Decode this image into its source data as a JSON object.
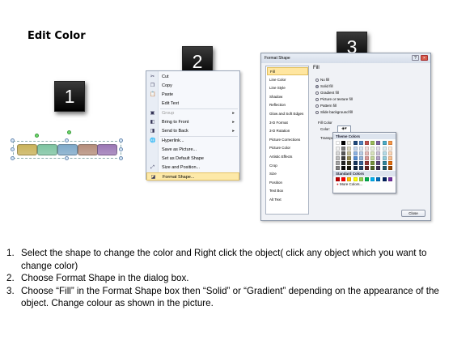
{
  "title": "Edit Color",
  "badges": [
    "1",
    "2",
    "3"
  ],
  "shape_colors": [
    "#c9b25a",
    "#7dc4a1",
    "#7ea9c9",
    "#b48e7b",
    "#9b78b5"
  ],
  "context_menu": {
    "items": [
      {
        "icon": "cut-icon",
        "glyph": "✂",
        "label": "Cut",
        "arrow": "",
        "disabled": false
      },
      {
        "icon": "copy-icon",
        "glyph": "❐",
        "label": "Copy",
        "arrow": "",
        "disabled": false
      },
      {
        "icon": "paste-icon",
        "glyph": "📋",
        "label": "Paste",
        "arrow": "",
        "disabled": false
      },
      {
        "icon": "",
        "glyph": "",
        "label": "Edit Text",
        "arrow": "",
        "disabled": false
      },
      {
        "icon": "group-icon",
        "glyph": "▣",
        "label": "Group",
        "arrow": "▸",
        "disabled": true
      },
      {
        "icon": "bring-to-front-icon",
        "glyph": "◧",
        "label": "Bring to Front",
        "arrow": "▸",
        "disabled": false
      },
      {
        "icon": "send-to-back-icon",
        "glyph": "◨",
        "label": "Send to Back",
        "arrow": "▸",
        "disabled": false
      },
      {
        "icon": "hyperlink-icon",
        "glyph": "🌐",
        "label": "Hyperlink...",
        "arrow": "",
        "disabled": false
      },
      {
        "icon": "",
        "glyph": "",
        "label": "Save as Picture...",
        "arrow": "",
        "disabled": false
      },
      {
        "icon": "",
        "glyph": "",
        "label": "Set as Default Shape",
        "arrow": "",
        "disabled": false
      },
      {
        "icon": "size-position-icon",
        "glyph": "⤢",
        "label": "Size and Position...",
        "arrow": "",
        "disabled": false
      },
      {
        "icon": "format-shape-icon",
        "glyph": "◪",
        "label": "Format Shape...",
        "arrow": "",
        "disabled": false,
        "highlight": true
      }
    ]
  },
  "dialog": {
    "title": "Format Shape",
    "nav": [
      "Fill",
      "Line Color",
      "Line Style",
      "Shadow",
      "Reflection",
      "Glow and Soft Edges",
      "3-D Format",
      "3-D Rotation",
      "Picture Corrections",
      "Picture Color",
      "Artistic Effects",
      "Crop",
      "Size",
      "Position",
      "Text Box",
      "Alt Text"
    ],
    "pane_title": "Fill",
    "options": [
      {
        "type": "radio",
        "label": "No fill",
        "on": false
      },
      {
        "type": "radio",
        "label": "Solid fill",
        "on": true
      },
      {
        "type": "radio",
        "label": "Gradient fill",
        "on": false
      },
      {
        "type": "radio",
        "label": "Picture or texture fill",
        "on": false
      },
      {
        "type": "radio",
        "label": "Pattern fill",
        "on": false
      },
      {
        "type": "radio",
        "label": "Slide background fill",
        "on": false
      }
    ],
    "fill_color_label": "Fill Color",
    "color_label": "Color:",
    "transparency_label": "Transpar",
    "close_label": "Close",
    "palette": {
      "theme_colors_label": "Theme Colors",
      "standard_colors_label": "Standard Colors",
      "more_colors_label": "More Colors...",
      "theme_top": [
        "#ffffff",
        "#000000",
        "#eeece1",
        "#1f497d",
        "#4f81bd",
        "#c0504d",
        "#9bbb59",
        "#8064a2",
        "#4bacc6",
        "#f79646"
      ],
      "theme_shades": [
        [
          "#f2f2f2",
          "#7f7f7f",
          "#ddd9c3",
          "#c6d9f0",
          "#dbe5f1",
          "#f2dcdb",
          "#ebf1dd",
          "#e5e0ec",
          "#dbeef3",
          "#fdeada"
        ],
        [
          "#d8d8d8",
          "#595959",
          "#c4bd97",
          "#8db3e2",
          "#b8cce4",
          "#e5b9b7",
          "#d7e3bc",
          "#ccc1d9",
          "#b7dde8",
          "#fbd5b5"
        ],
        [
          "#bfbfbf",
          "#3f3f3f",
          "#938953",
          "#548dd4",
          "#95b3d7",
          "#d99694",
          "#c3d69b",
          "#b2a2c7",
          "#92cddc",
          "#fac08f"
        ],
        [
          "#a5a5a5",
          "#262626",
          "#494429",
          "#17365d",
          "#366092",
          "#953734",
          "#76923c",
          "#5f497a",
          "#31859b",
          "#e36c09"
        ],
        [
          "#7f7f7f",
          "#0c0c0c",
          "#1d1b10",
          "#0f243e",
          "#244061",
          "#632423",
          "#4f6128",
          "#3f3151",
          "#205867",
          "#974806"
        ]
      ],
      "standard": [
        "#c00000",
        "#ff0000",
        "#ffc000",
        "#ffff00",
        "#92d050",
        "#00b050",
        "#00b0f0",
        "#0070c0",
        "#002060",
        "#7030a0"
      ]
    }
  },
  "steps": [
    {
      "num": "1.",
      "text": "Select the shape to change the color and Right click the object( click any object which you want to change color)"
    },
    {
      "num": "2.",
      "text": "Choose Format Shape in the dialog box."
    },
    {
      "num": "3.",
      "text": "Choose “Fill” in the Format Shape box then “Solid” or “Gradient” depending on the appearance of the object. Change colour as shown in the picture."
    }
  ]
}
